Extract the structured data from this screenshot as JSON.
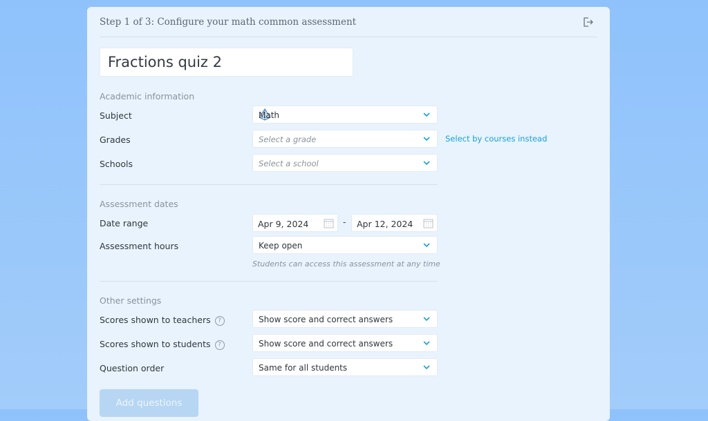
{
  "header": {
    "title": "Step 1 of 3: Configure your math common assessment",
    "exit_icon": "exit-icon"
  },
  "assessment_name": "Fractions quiz 2",
  "academic": {
    "title": "Academic information",
    "subject_label": "Subject",
    "subject_value": "Math",
    "subject_icon": "pyramid-icon",
    "grades_label": "Grades",
    "grades_placeholder": "Select a grade",
    "courses_link": "Select by courses instead",
    "schools_label": "Schools",
    "schools_placeholder": "Select a school"
  },
  "dates": {
    "title": "Assessment dates",
    "range_label": "Date range",
    "start": "Apr 9, 2024",
    "end": "Apr 12, 2024",
    "separator": "-",
    "hours_label": "Assessment hours",
    "hours_value": "Keep open",
    "hours_hint": "Students can access this assessment at any time"
  },
  "other": {
    "title": "Other settings",
    "teachers_label": "Scores shown to teachers",
    "teachers_value": "Show score and correct answers",
    "students_label": "Scores shown to students",
    "students_value": "Show score and correct answers",
    "order_label": "Question order",
    "order_value": "Same for all students",
    "help_glyph": "?"
  },
  "actions": {
    "add_questions": "Add questions"
  },
  "colors": {
    "accent_link": "#1aa0d8",
    "panel": "#e8f3fd",
    "button": "#b6d6f3"
  }
}
